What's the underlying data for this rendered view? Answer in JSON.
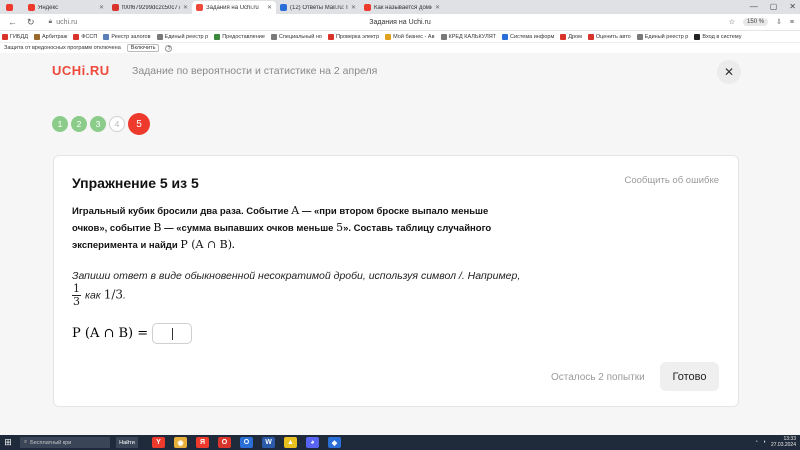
{
  "browser": {
    "tabs": [
      {
        "title": "",
        "icon": "yandex-icon",
        "color": "#ee3a2c",
        "active": false
      },
      {
        "title": "Яндекс",
        "icon": "yandex-icon",
        "color": "#ee3a2c",
        "active": false
      },
      {
        "title": "f00f679299dc2c50c777f",
        "icon": "doc-icon",
        "color": "#d9342b",
        "active": false
      },
      {
        "title": "Задания на Uchi.ru",
        "icon": "uchi-icon",
        "color": "#ee4a3c",
        "active": true
      },
      {
        "title": "(12) Ответы Mail.ru: Прос",
        "icon": "mail-icon",
        "color": "#2a6ed8",
        "active": false
      },
      {
        "title": "Как называется домини",
        "icon": "yandex-icon",
        "color": "#ee3a2c",
        "active": false
      }
    ],
    "address": "uchi.ru",
    "page_title": "Задания на Uchi.ru",
    "zoom": "150 %",
    "bookmarks": [
      {
        "label": "ГИБДД",
        "color": "#d9342b"
      },
      {
        "label": "Арбитраж",
        "color": "#9a6a2a"
      },
      {
        "label": "ФССП",
        "color": "#d9342b"
      },
      {
        "label": "Реестр залогов",
        "color": "#5a7fb8"
      },
      {
        "label": "Единый реестр р",
        "color": "#7a7a7a"
      },
      {
        "label": "Предоставление",
        "color": "#3a8a3a"
      },
      {
        "label": "Специальный но",
        "color": "#7a7a7a"
      },
      {
        "label": "Проверка электр",
        "color": "#d9342b"
      },
      {
        "label": "Мой бизнес - Ав",
        "color": "#e0a020"
      },
      {
        "label": "КРЕД КАЛЬКУЛЯТ",
        "color": "#7a7a7a"
      },
      {
        "label": "Система информ",
        "color": "#2a6ed8"
      },
      {
        "label": "Дром",
        "color": "#d9342b"
      },
      {
        "label": "Оценить авто",
        "color": "#d9342b"
      },
      {
        "label": "Единый реестр р",
        "color": "#7a7a7a"
      },
      {
        "label": "Вход в систему",
        "color": "#222222"
      }
    ],
    "protection_text": "Защита от вредоносных программ отключена",
    "protection_enable": "Включить",
    "protection_help": "?"
  },
  "page": {
    "logo": "UCHi.RU",
    "header_title": "Задание по вероятности и статистике на 2 апреля",
    "close_symbol": "✕",
    "steps": [
      {
        "label": "1",
        "state": "done"
      },
      {
        "label": "2",
        "state": "done"
      },
      {
        "label": "3",
        "state": "done"
      },
      {
        "label": "4",
        "state": "todo"
      },
      {
        "label": "5",
        "state": "current"
      }
    ]
  },
  "exercise": {
    "title": "Упражнение 5 из 5",
    "report_link": "Сообщить об ошибке",
    "problem": {
      "p1": "Игральный кубик бросили два раза. Событие ",
      "m1": "A",
      "p2": " — «при втором броске выпало меньше очков», событие ",
      "m2": "B",
      "p3": " — «сумма выпавших очков меньше ",
      "m3": "5",
      "p4": "». Составь таблицу случайного эксперимента и найди ",
      "m4": "P (A ∩ B)",
      "p5": "."
    },
    "instruction": "Запиши ответ в виде обыкновенной несократимой дроби, используя символ /. Например,",
    "example": {
      "numerator": "1",
      "denominator": "3",
      "text": "как",
      "math": "1/3",
      "end": "."
    },
    "answer_label": "P (A ∩ B) =",
    "answer_value": "",
    "attempts": "Осталось 2 попытки",
    "submit": "Готово"
  },
  "taskbar": {
    "search_placeholder": "Бесплатный кри",
    "weather": "Найти",
    "apps": [
      {
        "name": "yandex-browser-icon",
        "glyph": "Y",
        "color": "#ee3a2c"
      },
      {
        "name": "chrome-icon",
        "glyph": "◉",
        "color": "#e8b03a"
      },
      {
        "name": "yandex-icon",
        "glyph": "Я",
        "color": "#ee3a2c"
      },
      {
        "name": "opera-icon",
        "glyph": "O",
        "color": "#d9342b"
      },
      {
        "name": "outlook-icon",
        "glyph": "O",
        "color": "#2a6ed8"
      },
      {
        "name": "word-icon",
        "glyph": "W",
        "color": "#2a5aa8"
      },
      {
        "name": "app-icon",
        "glyph": "▲",
        "color": "#e8c020"
      },
      {
        "name": "discord-icon",
        "glyph": "◕",
        "color": "#5865f2"
      },
      {
        "name": "app-icon-2",
        "glyph": "◆",
        "color": "#2a6ed8"
      }
    ],
    "time": "13:33",
    "date": "27.03.2024"
  }
}
